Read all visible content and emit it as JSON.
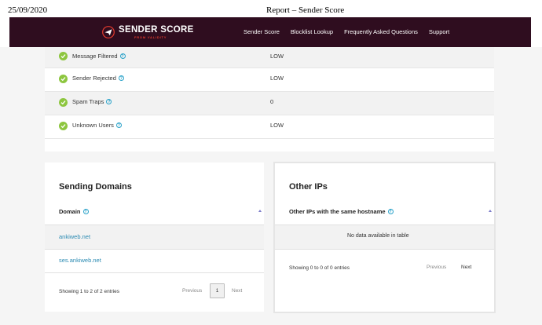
{
  "print_header": {
    "date": "25/09/2020",
    "title": "Report – Sender Score"
  },
  "navbar": {
    "logo_text": "SENDER SCORE",
    "logo_subtext": "FROM VALIDITY",
    "background_color": "#2f0d1f",
    "links": [
      "Sender Score",
      "Blocklist Lookup",
      "Frequently Asked Questions",
      "Support"
    ]
  },
  "metrics": [
    {
      "label": "Message Filtered",
      "value": "LOW",
      "icon": "check-icon"
    },
    {
      "label": "Sender Rejected",
      "value": "LOW",
      "icon": "check-icon"
    },
    {
      "label": "Spam Traps",
      "value": "0",
      "icon": "check-icon"
    },
    {
      "label": "Unknown Users",
      "value": "LOW",
      "icon": "check-icon"
    }
  ],
  "sending_domains": {
    "title": "Sending Domains",
    "column_header": "Domain",
    "rows": [
      "ankiweb.net",
      "ses.ankiweb.net"
    ],
    "info_text": "Showing 1 to 2 of 2 entries",
    "previous_label": "Previous",
    "current_page": "1",
    "next_label": "Next"
  },
  "other_ips": {
    "title": "Other IPs",
    "column_header": "Other IPs with the same hostname",
    "empty_text": "No data available in table",
    "info_text": "Showing 0 to 0 of 0 entries",
    "previous_label": "Previous",
    "next_label": "Next"
  },
  "colors": {
    "accent_link": "#2a8ab2",
    "check_green": "#8dc63f",
    "logo_red": "#e33b2e"
  }
}
